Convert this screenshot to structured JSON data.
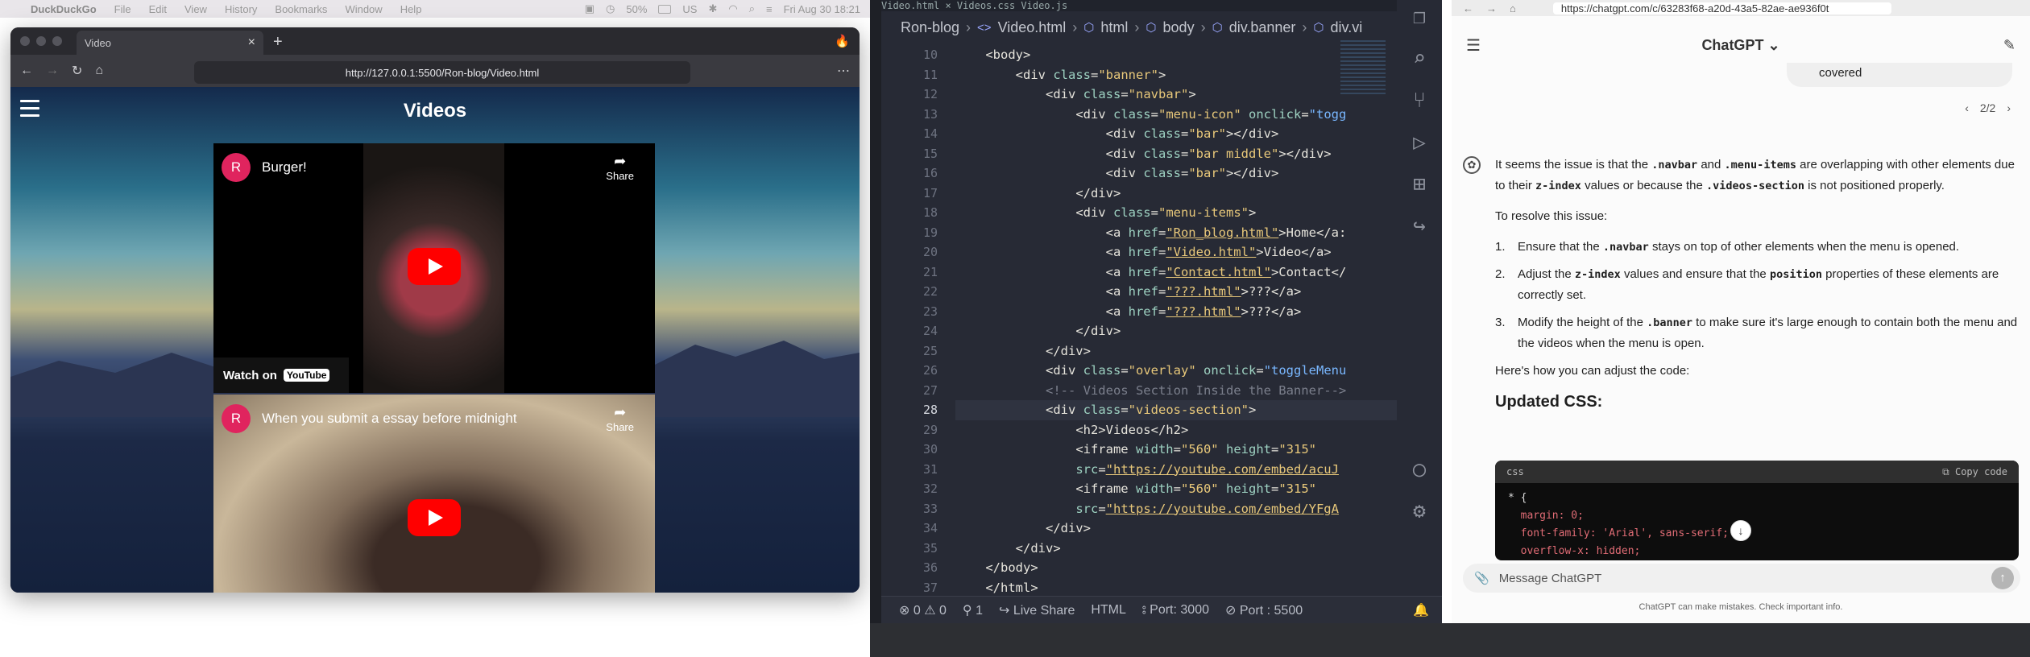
{
  "menubar": {
    "app_name": "DuckDuckGo",
    "items": [
      "File",
      "Edit",
      "View",
      "History",
      "Bookmarks",
      "Window",
      "Help"
    ],
    "battery": "50%",
    "keyboard": "US",
    "clock": "Fri Aug 30  18:21"
  },
  "browser": {
    "tab_title": "Video",
    "url": "http://127.0.0.1:5500/Ron-blog/Video.html",
    "page_title": "Videos",
    "videos": [
      {
        "avatar_letter": "R",
        "title": "Burger!",
        "share_label": "Share",
        "watch_label": "Watch on",
        "yt_label": "YouTube"
      },
      {
        "avatar_letter": "R",
        "title": "When you submit a essay before midnight",
        "share_label": "Share"
      }
    ]
  },
  "vscode": {
    "tabs": "Video.html  ×     Videos.css     Video.js",
    "breadcrumb": [
      "Ron-blog",
      "Video.html",
      "html",
      "body",
      "div.banner",
      "div.vi"
    ],
    "line_numbers": [
      10,
      11,
      12,
      13,
      14,
      15,
      16,
      17,
      18,
      19,
      20,
      21,
      22,
      23,
      24,
      25,
      26,
      27,
      28,
      29,
      30,
      31,
      32,
      33,
      34,
      35,
      36,
      37
    ],
    "active_line": 28,
    "code": [
      {
        "indent": "    ",
        "parts": [
          [
            "tag",
            "<body>"
          ]
        ]
      },
      {
        "indent": "        ",
        "parts": [
          [
            "tag",
            "<div "
          ],
          [
            "attr",
            "class"
          ],
          [
            "tag",
            "="
          ],
          [
            "str",
            "\"banner\""
          ],
          [
            "tag",
            ">"
          ]
        ]
      },
      {
        "indent": "            ",
        "parts": [
          [
            "tag",
            "<div "
          ],
          [
            "attr",
            "class"
          ],
          [
            "tag",
            "="
          ],
          [
            "str",
            "\"navbar\""
          ],
          [
            "tag",
            ">"
          ]
        ]
      },
      {
        "indent": "                ",
        "parts": [
          [
            "tag",
            "<div "
          ],
          [
            "attr",
            "class"
          ],
          [
            "tag",
            "="
          ],
          [
            "str",
            "\"menu-icon\""
          ],
          [
            "tag",
            " "
          ],
          [
            "attr",
            "onclick"
          ],
          [
            "tag",
            "="
          ],
          [
            "fn",
            "\"togg"
          ]
        ]
      },
      {
        "indent": "                    ",
        "parts": [
          [
            "tag",
            "<div "
          ],
          [
            "attr",
            "class"
          ],
          [
            "tag",
            "="
          ],
          [
            "str",
            "\"bar\""
          ],
          [
            "tag",
            "></div>"
          ]
        ]
      },
      {
        "indent": "                    ",
        "parts": [
          [
            "tag",
            "<div "
          ],
          [
            "attr",
            "class"
          ],
          [
            "tag",
            "="
          ],
          [
            "str",
            "\"bar middle\""
          ],
          [
            "tag",
            "></div>"
          ]
        ]
      },
      {
        "indent": "                    ",
        "parts": [
          [
            "tag",
            "<div "
          ],
          [
            "attr",
            "class"
          ],
          [
            "tag",
            "="
          ],
          [
            "str",
            "\"bar\""
          ],
          [
            "tag",
            "></div>"
          ]
        ]
      },
      {
        "indent": "                ",
        "parts": [
          [
            "tag",
            "</div>"
          ]
        ]
      },
      {
        "indent": "                ",
        "parts": [
          [
            "tag",
            "<div "
          ],
          [
            "attr",
            "class"
          ],
          [
            "tag",
            "="
          ],
          [
            "str",
            "\"menu-items\""
          ],
          [
            "tag",
            ">"
          ]
        ]
      },
      {
        "indent": "                    ",
        "parts": [
          [
            "tag",
            "<a "
          ],
          [
            "attr",
            "href"
          ],
          [
            "tag",
            "="
          ],
          [
            "link",
            "\"Ron_blog.html\""
          ],
          [
            "tag",
            ">Home</a:"
          ]
        ]
      },
      {
        "indent": "                    ",
        "parts": [
          [
            "tag",
            "<a "
          ],
          [
            "attr",
            "href"
          ],
          [
            "tag",
            "="
          ],
          [
            "link",
            "\"Video.html\""
          ],
          [
            "tag",
            ">Video</a>"
          ]
        ]
      },
      {
        "indent": "                    ",
        "parts": [
          [
            "tag",
            "<a "
          ],
          [
            "attr",
            "href"
          ],
          [
            "tag",
            "="
          ],
          [
            "link",
            "\"Contact.html\""
          ],
          [
            "tag",
            ">Contact</"
          ]
        ]
      },
      {
        "indent": "                    ",
        "parts": [
          [
            "tag",
            "<a "
          ],
          [
            "attr",
            "href"
          ],
          [
            "tag",
            "="
          ],
          [
            "link",
            "\"???.html\""
          ],
          [
            "tag",
            ">???</a>"
          ]
        ]
      },
      {
        "indent": "                    ",
        "parts": [
          [
            "tag",
            "<a "
          ],
          [
            "attr",
            "href"
          ],
          [
            "tag",
            "="
          ],
          [
            "link",
            "\"???.html\""
          ],
          [
            "tag",
            ">???</a>"
          ]
        ]
      },
      {
        "indent": "                ",
        "parts": [
          [
            "tag",
            "</div>"
          ]
        ]
      },
      {
        "indent": "            ",
        "parts": [
          [
            "tag",
            "</div>"
          ]
        ]
      },
      {
        "indent": "            ",
        "parts": [
          [
            "tag",
            "<div "
          ],
          [
            "attr",
            "class"
          ],
          [
            "tag",
            "="
          ],
          [
            "str",
            "\"overlay\""
          ],
          [
            "tag",
            " "
          ],
          [
            "attr",
            "onclick"
          ],
          [
            "tag",
            "="
          ],
          [
            "fn",
            "\"toggleMenu"
          ]
        ]
      },
      {
        "indent": "            ",
        "parts": [
          [
            "cm",
            "<!-- Videos Section Inside the Banner-->"
          ]
        ]
      },
      {
        "indent": "            ",
        "parts": [
          [
            "tag",
            "<div "
          ],
          [
            "attr",
            "class"
          ],
          [
            "tag",
            "="
          ],
          [
            "str",
            "\"videos-section\""
          ],
          [
            "tag",
            ">"
          ]
        ]
      },
      {
        "indent": "                ",
        "parts": [
          [
            "tag",
            "<h2>Videos</h2>"
          ]
        ]
      },
      {
        "indent": "                ",
        "parts": [
          [
            "tag",
            "<iframe "
          ],
          [
            "attr",
            "width"
          ],
          [
            "tag",
            "="
          ],
          [
            "str",
            "\"560\""
          ],
          [
            "tag",
            " "
          ],
          [
            "attr",
            "height"
          ],
          [
            "tag",
            "="
          ],
          [
            "str",
            "\"315\""
          ]
        ]
      },
      {
        "indent": "                ",
        "parts": [
          [
            "attr",
            "src"
          ],
          [
            "tag",
            "="
          ],
          [
            "link",
            "\"https://youtube.com/embed/acuJ"
          ]
        ]
      },
      {
        "indent": "                ",
        "parts": [
          [
            "tag",
            "<iframe "
          ],
          [
            "attr",
            "width"
          ],
          [
            "tag",
            "="
          ],
          [
            "str",
            "\"560\""
          ],
          [
            "tag",
            " "
          ],
          [
            "attr",
            "height"
          ],
          [
            "tag",
            "="
          ],
          [
            "str",
            "\"315\""
          ]
        ]
      },
      {
        "indent": "                ",
        "parts": [
          [
            "attr",
            "src"
          ],
          [
            "tag",
            "="
          ],
          [
            "link",
            "\"https://youtube.com/embed/YFgA"
          ]
        ]
      },
      {
        "indent": "            ",
        "parts": [
          [
            "tag",
            "</div>"
          ]
        ]
      },
      {
        "indent": "        ",
        "parts": [
          [
            "tag",
            "</div>"
          ]
        ]
      },
      {
        "indent": "    ",
        "parts": [
          [
            "tag",
            "</body>"
          ]
        ]
      },
      {
        "indent": "    ",
        "parts": [
          [
            "tag",
            "</html>"
          ]
        ]
      }
    ],
    "status": {
      "errors": "0",
      "warnings": "0",
      "ports_count": "1",
      "live_share": "Live Share",
      "language": "HTML",
      "port1": "Port: 3000",
      "port2": "Port : 5500"
    }
  },
  "chat": {
    "url": "https://chatgpt.com/c/63283f68-a20d-43a5-82ae-ae936f0t",
    "model": "ChatGPT",
    "user_tail": "covered",
    "pager": "2/2",
    "intro": "It seems the issue is that the `.navbar` and `.menu-items` are overlapping with other elements due to their `z-index` values or because the `.videos-section` is not positioned properly.",
    "resolve": "To resolve this issue:",
    "steps": [
      "Ensure that the `.navbar` stays on top of other elements when the menu is opened.",
      "Adjust the `z-index` values and ensure that the `position` properties of these elements are correctly set.",
      "Modify the height of the `.banner` to make sure it's large enough to contain both the menu and the videos when the menu is open."
    ],
    "howto": "Here's how you can adjust the code:",
    "css_heading": "Updated CSS:",
    "code_lang": "css",
    "copy_label": "Copy code",
    "code_lines": [
      "* {",
      "  margin: 0;",
      "  font-family: 'Arial', sans-serif;",
      "  overflow-x: hidden;"
    ],
    "placeholder": "Message ChatGPT",
    "disclaimer": "ChatGPT can make mistakes. Check important info."
  }
}
